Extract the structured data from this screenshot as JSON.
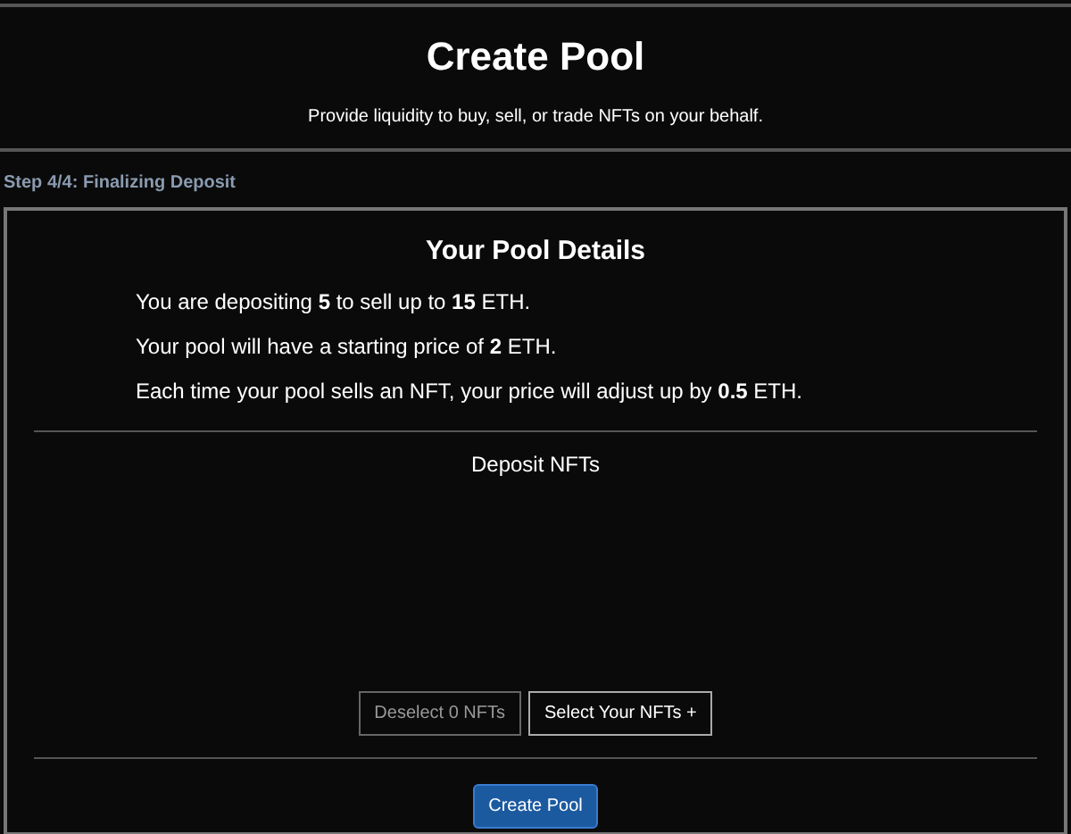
{
  "header": {
    "title": "Create Pool",
    "subtitle": "Provide liquidity to buy, sell, or trade NFTs on your behalf."
  },
  "step": "Step 4/4: Finalizing Deposit",
  "details": {
    "title": "Your Pool Details",
    "lines": [
      "You are depositing **5** to sell up to **15** ETH.",
      "Your pool will have a starting price of **2** ETH.",
      "Each time your pool sells an NFT, your price will adjust up by **0.5** ETH."
    ]
  },
  "deposit": {
    "title": "Deposit NFTs",
    "buttons": [
      {
        "label": "Deselect 0 NFTs",
        "disabled": true
      },
      {
        "label": "Select Your NFTs +",
        "disabled": false
      }
    ]
  },
  "submit": {
    "label": "Create Pool"
  }
}
